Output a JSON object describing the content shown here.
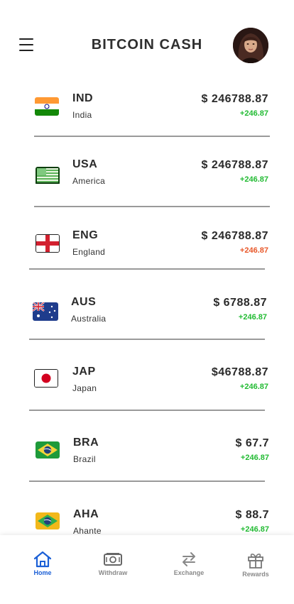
{
  "header": {
    "title": "BITCOIN CASH"
  },
  "currencies": [
    {
      "code": "IND",
      "name": "India",
      "price": "$ 246788.87",
      "change": "+246.87",
      "change_color": "#22bb33",
      "flag": "india-flag"
    },
    {
      "code": "USA",
      "name": "America",
      "price": "$ 246788.87",
      "change": "+246.87",
      "change_color": "#22bb33",
      "flag": "usa-flag"
    },
    {
      "code": "ENG",
      "name": "England",
      "price": "$ 246788.87",
      "change": "+246.87",
      "change_color": "#e8582a",
      "flag": "england-flag"
    },
    {
      "code": "AUS",
      "name": "Australia",
      "price": "$ 6788.87",
      "change": "+246.87",
      "change_color": "#22bb33",
      "flag": "australia-flag"
    },
    {
      "code": "JAP",
      "name": "Japan",
      "price": "$46788.87",
      "change": "+246.87",
      "change_color": "#22bb33",
      "flag": "japan-flag"
    },
    {
      "code": "BRA",
      "name": "Brazil",
      "price": "$ 67.7",
      "change": "+246.87",
      "change_color": "#22bb33",
      "flag": "brazil-flag"
    },
    {
      "code": "AHA",
      "name": "Ahante",
      "price": "$ 88.7",
      "change": "+246.87",
      "change_color": "#22bb33",
      "flag": "brazil-flag-alt"
    }
  ],
  "nav": {
    "items": [
      {
        "label": "Home",
        "icon": "home-icon",
        "active": true
      },
      {
        "label": "Withdraw",
        "icon": "withdraw-icon",
        "active": false
      },
      {
        "label": "Exchange",
        "icon": "exchange-icon",
        "active": false
      },
      {
        "label": "Rewards",
        "icon": "rewards-icon",
        "active": false
      }
    ]
  },
  "colors": {
    "positive": "#22bb33",
    "negative": "#e8582a",
    "accent": "#1a5fd6"
  }
}
